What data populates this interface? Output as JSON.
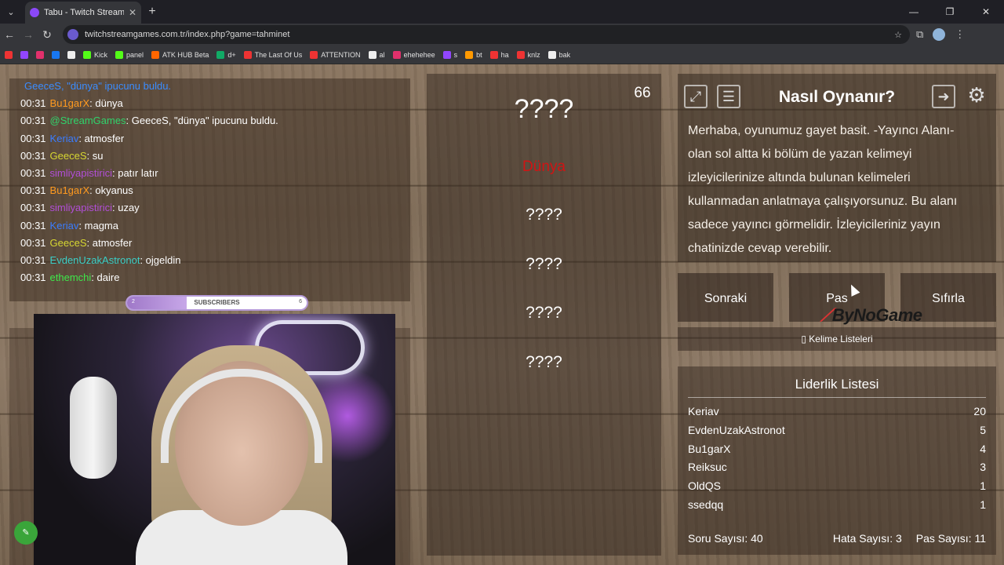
{
  "browser": {
    "tab_title": "Tabu - Twitch Stream Game",
    "url": "twitchstreamgames.com.tr/index.php?game=tahminet",
    "bookmarks": [
      "Kick",
      "panel",
      "ATK HUB Beta",
      "d+",
      "The Last Of Us",
      "ATTENTION",
      "al",
      "ehehehee",
      "s",
      "bt",
      "ha",
      "knlz",
      "bak"
    ]
  },
  "chat": {
    "lines": [
      {
        "time": "",
        "user": "GeeceS, ",
        "user_color": "#3a8cff",
        "text": "\"dünya\" ipucunu buldu.",
        "text_color": "#3a8cff"
      },
      {
        "time": "00:31",
        "user": "Bu1garX",
        "user_color": "#ff9a1f",
        "text": ": dünya"
      },
      {
        "time": "00:31",
        "user": "@StreamGames",
        "user_color": "#2fd36b",
        "text": ": GeeceS, \"dünya\" ipucunu buldu."
      },
      {
        "time": "00:31",
        "user": "Keriav",
        "user_color": "#3a7cff",
        "text": ": atmosfer"
      },
      {
        "time": "00:31",
        "user": "GeeceS",
        "user_color": "#d6d632",
        "text": ": su"
      },
      {
        "time": "00:31",
        "user": "simliyapistirici",
        "user_color": "#b24ed8",
        "text": ": patır latır"
      },
      {
        "time": "00:31",
        "user": "Bu1garX",
        "user_color": "#ff9a1f",
        "text": ": okyanus"
      },
      {
        "time": "00:31",
        "user": "simliyapistirici",
        "user_color": "#b24ed8",
        "text": ": uzay"
      },
      {
        "time": "00:31",
        "user": "Keriav",
        "user_color": "#3a7cff",
        "text": ": magma"
      },
      {
        "time": "00:31",
        "user": "GeeceS",
        "user_color": "#d6d632",
        "text": ": atmosfer"
      },
      {
        "time": "00:31",
        "user": "EvdenUzakAstronot",
        "user_color": "#3bd0c8",
        "text": ": ojgeldin"
      },
      {
        "time": "00:31",
        "user": "ethemchi",
        "user_color": "#3ee84a",
        "text": ": daire"
      }
    ],
    "sub_bar": {
      "label": "SUBSCRIBERS",
      "current": "2",
      "goal": "6",
      "progress": 0.33
    }
  },
  "game": {
    "timer": "66",
    "words": [
      "????",
      "Dünya",
      "????",
      "????",
      "????",
      "????"
    ],
    "found_word": "Dünya"
  },
  "howto": {
    "title": "Nasıl Oynanır?",
    "text": "Merhaba, oyunumuz gayet basit. -Yayıncı Alanı- olan sol altta ki bölüm de yazan kelimeyi izleyicilerinize altında bulunan kelimeleri kullanmadan anlatmaya çalışıyorsunuz. Bu alanı sadece yayıncı görmelidir. İzleyicileriniz yayın chatinizde cevap verebilir."
  },
  "controls": {
    "next": "Sonraki",
    "pass": "Pas",
    "reset": "Sıfırla",
    "word_lists": "Kelime Listeleri"
  },
  "logo": "ByNoGame",
  "leaderboard": {
    "title": "Liderlik Listesi",
    "rows": [
      {
        "name": "Keriav",
        "score": "20"
      },
      {
        "name": "EvdenUzakAstronot",
        "score": "5"
      },
      {
        "name": "Bu1garX",
        "score": "4"
      },
      {
        "name": "Reiksuc",
        "score": "3"
      },
      {
        "name": "OldQS",
        "score": "1"
      },
      {
        "name": "ssedqq",
        "score": "1"
      }
    ]
  },
  "stats": {
    "questions": "Soru Sayısı: 40",
    "errors": "Hata Sayısı: 3",
    "passes": "Pas Sayısı: 11"
  }
}
